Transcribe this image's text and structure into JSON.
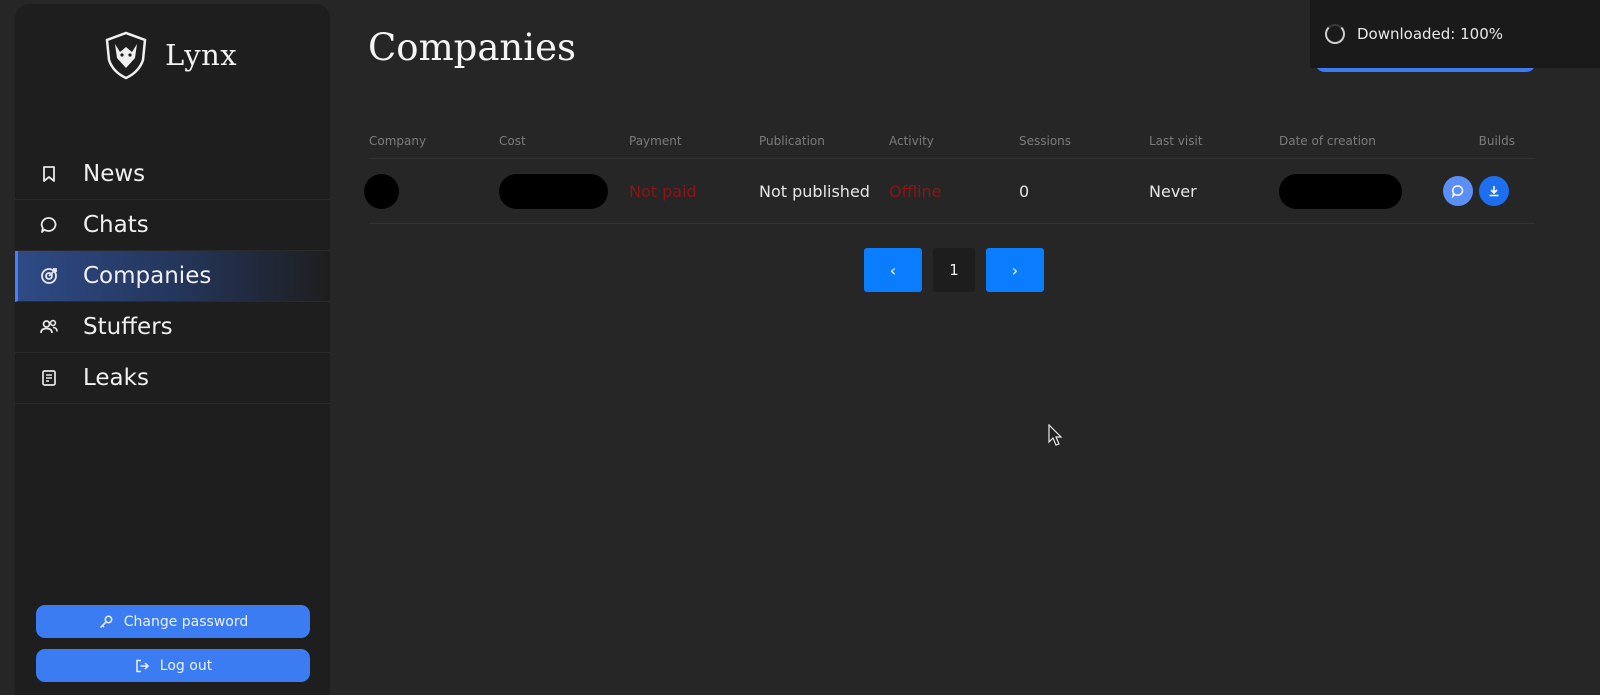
{
  "brand": {
    "name": "Lynx"
  },
  "sidebar": {
    "items": [
      {
        "label": "News",
        "icon": "bookmark-icon",
        "active": false
      },
      {
        "label": "Chats",
        "icon": "chat-bubble-icon",
        "active": false
      },
      {
        "label": "Companies",
        "icon": "target-icon",
        "active": true
      },
      {
        "label": "Stuffers",
        "icon": "users-icon",
        "active": false
      },
      {
        "label": "Leaks",
        "icon": "document-icon",
        "active": false
      }
    ],
    "change_password_label": "Change password",
    "logout_label": "Log out"
  },
  "page": {
    "title": "Companies"
  },
  "toast": {
    "text": "Downloaded: 100%"
  },
  "table": {
    "columns": [
      "Company",
      "Cost",
      "Payment",
      "Publication",
      "Activity",
      "Sessions",
      "Last visit",
      "Date of creation",
      "Builds"
    ],
    "rows": [
      {
        "payment": "Not paid",
        "publication": "Not published",
        "activity": "Offline",
        "sessions": "0",
        "last_visit": "Never"
      }
    ]
  },
  "pagination": {
    "prev": "‹",
    "current": "1",
    "next": "›"
  },
  "colors": {
    "accent": "#3b7cf2",
    "pager_blue": "#0a7dff",
    "danger": "#8b1515",
    "background": "#262626",
    "sidebar": "#1e1e1e"
  }
}
